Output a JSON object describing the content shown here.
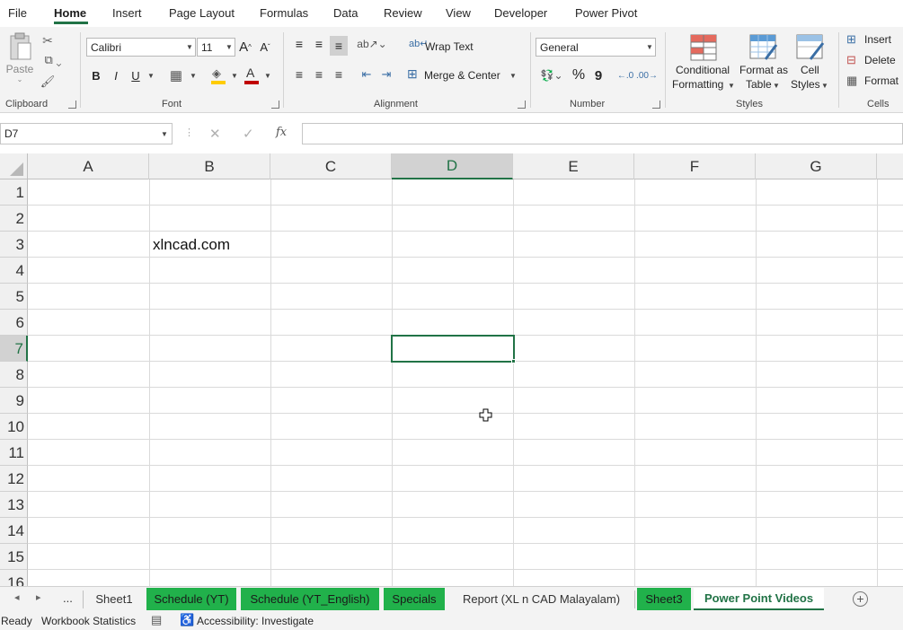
{
  "menu_tabs": [
    "File",
    "Home",
    "Insert",
    "Page Layout",
    "Formulas",
    "Data",
    "Review",
    "View",
    "Developer",
    "Power Pivot"
  ],
  "active_tab": "Home",
  "ribbon": {
    "clipboard": {
      "paste": "Paste",
      "label": "Clipboard"
    },
    "font": {
      "family": "Calibri",
      "size": "11",
      "bold": "B",
      "italic": "I",
      "underline": "U",
      "label": "Font",
      "grow": "A",
      "shrink": "A"
    },
    "alignment": {
      "wrap_text": "Wrap Text",
      "merge_center": "Merge & Center",
      "label": "Alignment"
    },
    "number": {
      "format": "General",
      "percent": "%",
      "comma": "9",
      "label": "Number"
    },
    "styles": {
      "conditional_formatting_1": "Conditional",
      "conditional_formatting_2": "Formatting",
      "format_as_table_1": "Format as",
      "format_as_table_2": "Table",
      "cell_styles_1": "Cell",
      "cell_styles_2": "Styles",
      "label": "Styles"
    },
    "cells": {
      "insert": "Insert",
      "delete": "Delete",
      "format": "Format",
      "label": "Cells"
    }
  },
  "formula_bar": {
    "name_box": "D7",
    "fx": "fx",
    "value": ""
  },
  "columns": [
    "A",
    "B",
    "C",
    "D",
    "E",
    "F",
    "G"
  ],
  "rows": [
    "1",
    "2",
    "3",
    "4",
    "5",
    "6",
    "7",
    "8",
    "9",
    "10",
    "11",
    "12",
    "13",
    "14",
    "15",
    "16"
  ],
  "selected_cell": "D7",
  "cells": {
    "B3": "xlncad.com"
  },
  "sheet_nav": {
    "prev": "◂",
    "next": "▸",
    "more": "..."
  },
  "sheet_tabs": [
    {
      "name": "Sheet1",
      "color": "none"
    },
    {
      "name": "Schedule (YT)",
      "color": "#21b14b"
    },
    {
      "name": "Schedule (YT_English)",
      "color": "#21b14b"
    },
    {
      "name": "Specials",
      "color": "#21b14b"
    },
    {
      "name": "Report (XL n CAD Malayalam)",
      "color": "none"
    },
    {
      "name": "Sheet3",
      "color": "#21b14b"
    },
    {
      "name": "Power Point Videos",
      "color": "active"
    }
  ],
  "status_bar": {
    "ready": "Ready",
    "workbook_statistics": "Workbook Statistics",
    "accessibility": "Accessibility: Investigate"
  },
  "colors": {
    "accent": "#217346",
    "tab_green": "#21b14b"
  }
}
